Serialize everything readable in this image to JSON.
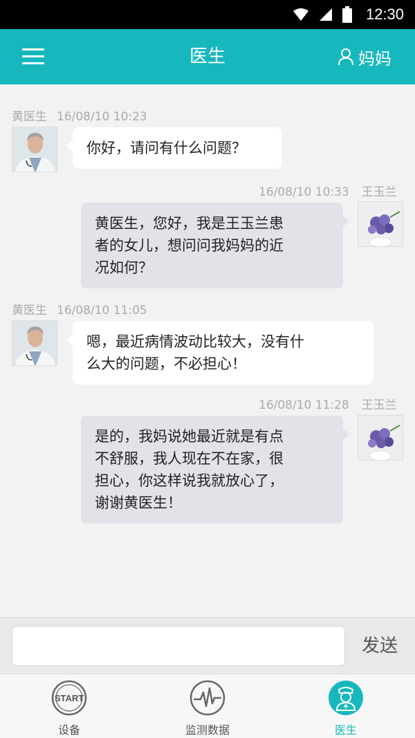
{
  "status_bar": {
    "time": "12:30"
  },
  "header": {
    "title": "医生",
    "user_label": "妈妈"
  },
  "messages": [
    {
      "sender": "黄医生",
      "timestamp": "16/08/10 10:23",
      "direction": "incoming",
      "lines": [
        "你好，请问有什么问题？"
      ]
    },
    {
      "sender": "王玉兰",
      "timestamp": "16/08/10 10:33",
      "direction": "outgoing",
      "lines": [
        "黄医生，您好，我是王玉兰患",
        "者的女儿，想问问我妈妈的近",
        "况如何？"
      ]
    },
    {
      "sender": "黄医生",
      "timestamp": "16/08/10 11:05",
      "direction": "incoming",
      "lines": [
        "嗯，最近病情波动比较大，没有什",
        "么大的问题，不必担心！"
      ]
    },
    {
      "sender": "王玉兰",
      "timestamp": "16/08/10 11:28",
      "direction": "outgoing",
      "lines": [
        "是的，我妈说她最近就是有点",
        "不舒服，我人现在不在家，很",
        "担心，你这样说我就放心了，",
        "谢谢黄医生！"
      ]
    }
  ],
  "input_bar": {
    "placeholder": "",
    "send_label": "发送"
  },
  "tabs": [
    {
      "label": "设备",
      "icon": "start-icon",
      "icon_text": "START",
      "active": false
    },
    {
      "label": "监测数据",
      "icon": "pulse-icon",
      "active": false
    },
    {
      "label": "医生",
      "icon": "doctor-icon",
      "active": true
    }
  ],
  "colors": {
    "accent": "#17b8bd",
    "incoming_bubble": "#ffffff",
    "outgoing_bubble": "#e2e3e8"
  }
}
